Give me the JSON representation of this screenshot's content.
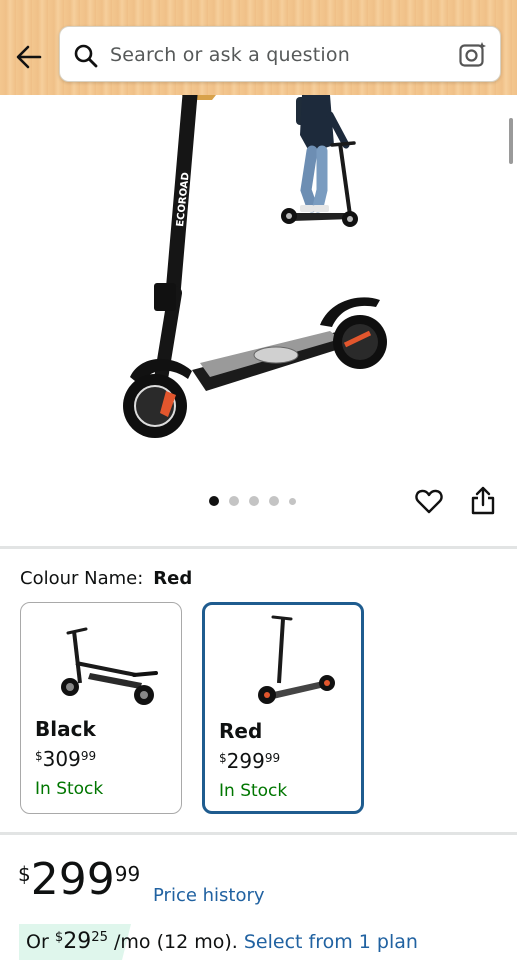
{
  "header": {
    "search_placeholder": "Search or ask a question"
  },
  "gallery": {
    "brand_text": "ECOROAD",
    "dots_total": 5,
    "active_dot": 0
  },
  "colour": {
    "label": "Colour Name:",
    "selected": "Red",
    "options": [
      {
        "name": "Black",
        "currency": "$",
        "price_whole": "309",
        "price_cents": "99",
        "stock": "In Stock"
      },
      {
        "name": "Red",
        "currency": "$",
        "price_whole": "299",
        "price_cents": "99",
        "stock": "In Stock"
      }
    ]
  },
  "price": {
    "currency": "$",
    "whole": "299",
    "cents": "99",
    "history_link": "Price history"
  },
  "financing": {
    "prefix": "Or ",
    "currency": "$",
    "whole": "29",
    "cents": "25",
    "suffix": " /mo (12 mo). ",
    "link": "Select from 1 plan"
  },
  "colors": {
    "accent_link": "#2162a1",
    "in_stock": "#007600",
    "selected_border": "#1f5c8f",
    "header_bg": "#f3c78f"
  },
  "icons": [
    "back-arrow-icon",
    "search-icon",
    "camera-search-icon",
    "heart-icon",
    "share-icon"
  ]
}
